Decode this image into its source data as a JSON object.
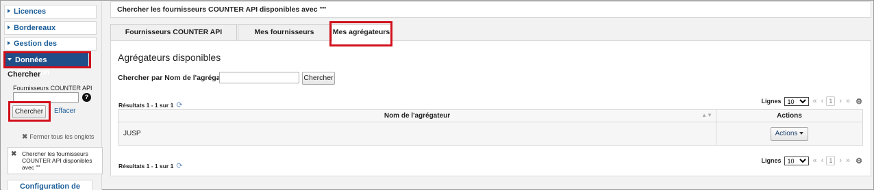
{
  "sidebar": {
    "items": [
      {
        "label": "Licences"
      },
      {
        "label": "Bordereaux"
      },
      {
        "label": "Gestion des collections"
      },
      {
        "label": "Données d'utilisation"
      }
    ],
    "search_title": "Chercher",
    "field_label": "Fournisseurs COUNTER API",
    "help_icon": "?",
    "search_button": "Chercher",
    "clear_link": "Effacer",
    "close_tabs": "Fermer tous les onglets",
    "open_tab_label": "Chercher les fournisseurs COUNTER API disponibles avec \"\"",
    "config_label": "Configuration de"
  },
  "main": {
    "header": "Chercher les fournisseurs COUNTER API disponibles avec \"\"",
    "tabs": [
      {
        "label": "Fournisseurs COUNTER API disponibles"
      },
      {
        "label": "Mes fournisseurs demandés"
      },
      {
        "label": "Mes agrégateurs"
      }
    ],
    "panel_title": "Agrégateurs disponibles",
    "search_label": "Chercher par Nom de l'agrégateur",
    "search_button": "Chercher",
    "results_text": "Résultats 1 - 1 sur 1",
    "lines_label": "Lignes",
    "lines_value": "10",
    "page_number": "1",
    "table": {
      "columns": [
        "Nom de l'agrégateur",
        "Actions"
      ],
      "rows": [
        {
          "name": "JUSP",
          "action": "Actions"
        }
      ]
    }
  },
  "colors": {
    "accent": "#1f4e89",
    "link": "#1b5e99",
    "highlight_box": "#d10f1b"
  }
}
